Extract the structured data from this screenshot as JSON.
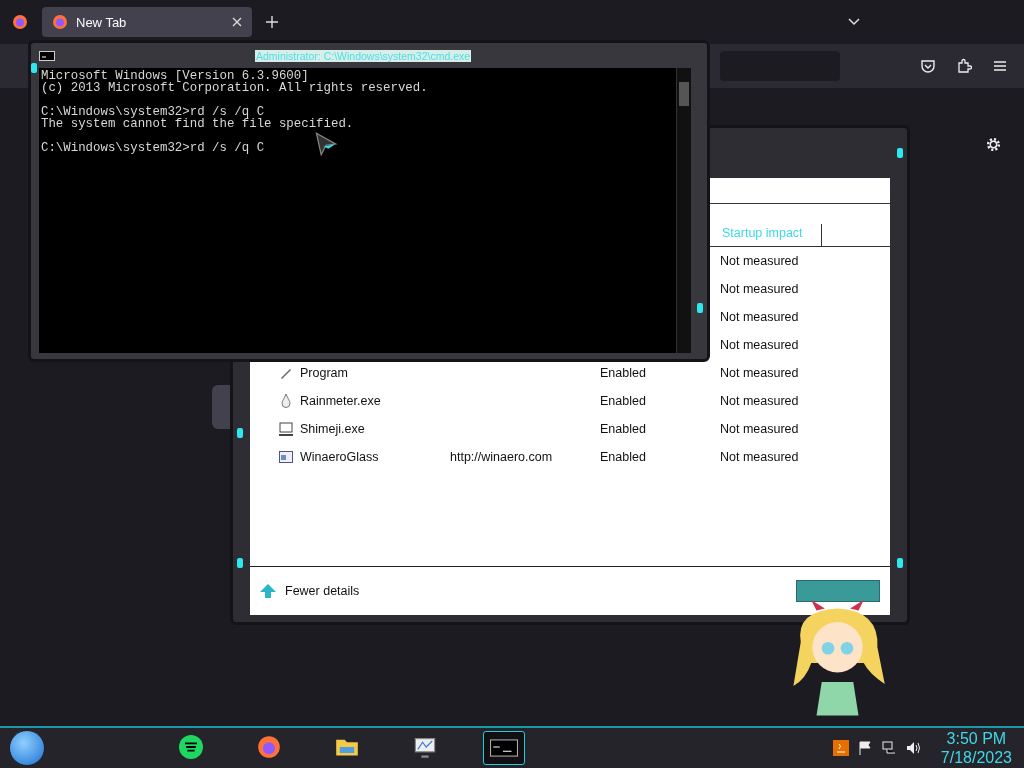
{
  "browser": {
    "tabs": [
      {
        "label": "New Tab",
        "selected": true
      }
    ]
  },
  "cmd": {
    "title": "Administrator: C:\\Windows\\system32\\cmd.exe",
    "blocks": [
      [
        "Microsoft Windows [Version 6.3.9600]",
        "(c) 2013 Microsoft Corporation. All rights reserved."
      ],
      [
        "C:\\Windows\\system32>rd /s /q C",
        "The system cannot find the file specified."
      ],
      [
        "C:\\Windows\\system32>rd /s /q C"
      ]
    ]
  },
  "task_manager": {
    "columns": [
      {
        "label": "Startup impact"
      }
    ],
    "rows": [
      {
        "impact": "Not measured"
      },
      {
        "impact": "Not measured"
      },
      {
        "impact": "Not measured"
      },
      {
        "impact": "Not measured"
      },
      {
        "kind": "pen",
        "name": "Program",
        "status": "Enabled",
        "impact": "Not measured"
      },
      {
        "kind": "drop",
        "name": "Rainmeter.exe",
        "status": "Enabled",
        "impact": "Not measured"
      },
      {
        "kind": "monitor",
        "name": "Shimeji.exe",
        "status": "Enabled",
        "impact": "Not measured"
      },
      {
        "kind": "window",
        "name": "WinaeroGlass",
        "publisher": "http://winaero.com",
        "status": "Enabled",
        "impact": "Not measured"
      }
    ],
    "fewer_details": "Fewer details"
  },
  "taskbar": {
    "apps": [
      {
        "kind": "music",
        "selected": false
      },
      {
        "kind": "browser",
        "selected": false
      },
      {
        "kind": "folder",
        "selected": false
      },
      {
        "kind": "monitor",
        "selected": false
      },
      {
        "kind": "console",
        "selected": true
      }
    ],
    "time": "3:50 PM",
    "date": "7/18/2023"
  }
}
